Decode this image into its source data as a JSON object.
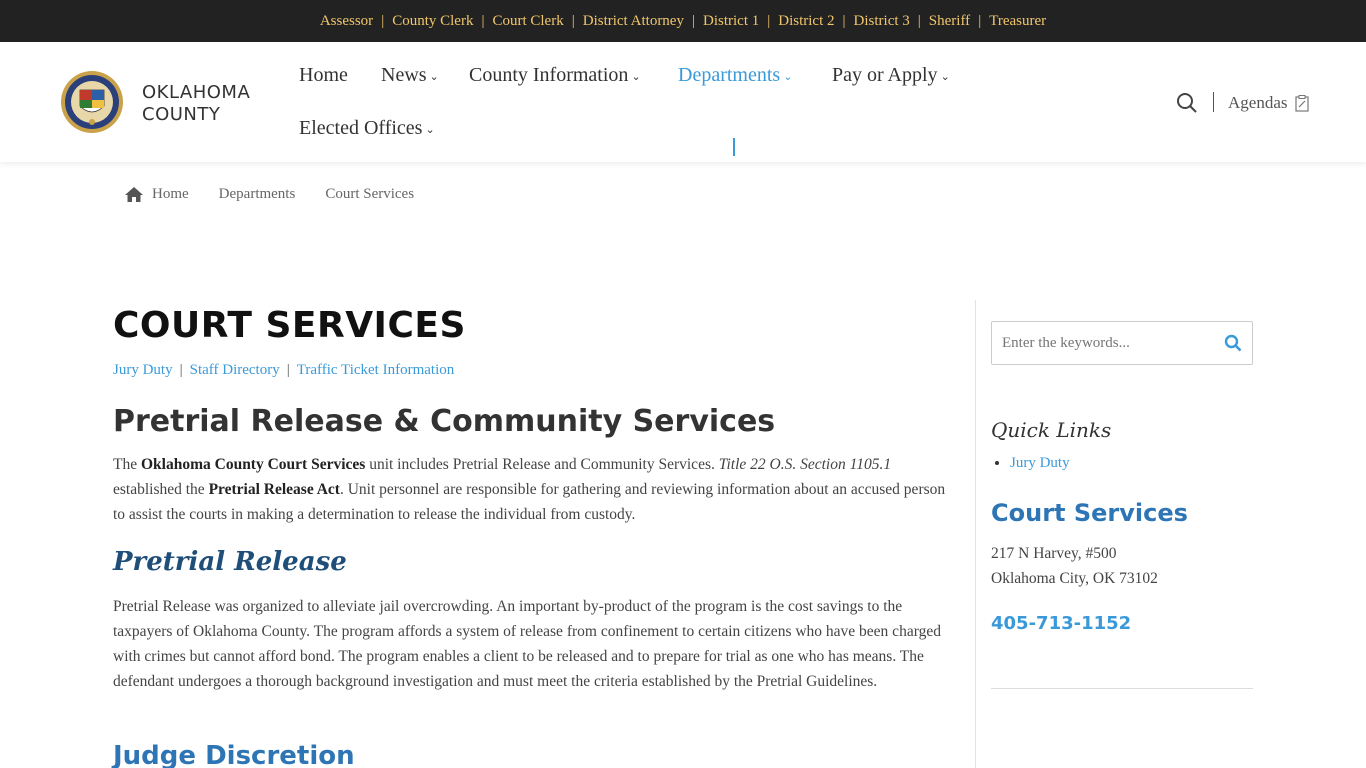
{
  "topbar": {
    "links": [
      "Assessor",
      "County Clerk",
      "Court Clerk",
      "District Attorney",
      "District 1",
      "District 2",
      "District 3",
      "Sheriff",
      "Treasurer"
    ]
  },
  "header": {
    "brand_line1": "OKLAHOMA",
    "brand_line2": "COUNTY",
    "nav": {
      "home": "Home",
      "news": "News",
      "county_info": "County Information",
      "departments": "Departments",
      "pay_apply": "Pay or Apply",
      "elected": "Elected Offices"
    },
    "agendas": "Agendas"
  },
  "breadcrumb": {
    "home": "Home",
    "departments": "Departments",
    "current": "Court Services"
  },
  "main": {
    "title": "COURT SERVICES",
    "sublinks": [
      "Jury Duty",
      "Staff Directory",
      "Traffic Ticket Information"
    ],
    "heading": "Pretrial Release & Community Services",
    "intro": {
      "t1": "The ",
      "b1": "Oklahoma County Court Services",
      "t2": " unit includes Pretrial Release and Community Services. ",
      "i1": "Title 22 O.S. Section 1105.1",
      "t3": " established the ",
      "b2": "Pretrial Release Act",
      "t4": ". Unit personnel are responsible for gathering and reviewing information about an accused person to assist the courts in making a determination to release the individual from custody."
    },
    "pretrial_heading": "Pretrial Release",
    "pretrial_text": "Pretrial Release was organized to alleviate jail overcrowding. An important by-product of the program is the cost savings to the taxpayers of Oklahoma County. The program affords a system of release from confinement to certain citizens who have been charged with crimes but cannot afford bond. The program enables a client to be released and to prepare for trial as one who has means. The defendant undergoes a thorough background investigation and must meet the criteria established by the Pretrial Guidelines.",
    "judge_heading": "Judge Discretion"
  },
  "sidebar": {
    "search_placeholder": "Enter the keywords...",
    "quick_links_title": "Quick Links",
    "quick_links": [
      "Jury Duty"
    ],
    "office_title": "Court Services",
    "address_line1": "217 N Harvey, #500",
    "address_line2": "Oklahoma City, OK 73102",
    "phone": "405-713-1152"
  },
  "colors": {
    "topbar_bg": "#222222",
    "topbar_link": "#f0c66b",
    "accent": "#3a9ad9",
    "heading_blue": "#2e75b6",
    "navy": "#1f4e79"
  }
}
